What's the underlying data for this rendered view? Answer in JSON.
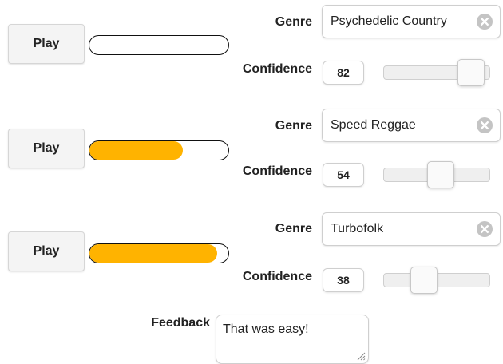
{
  "play_label": "Play",
  "genre_label": "Genre",
  "confidence_label": "Confidence",
  "rows": [
    {
      "genre": "Psychedelic Country",
      "confidence": "82",
      "progress": 0.0
    },
    {
      "genre": "Speed Reggae",
      "confidence": "54",
      "progress": 0.67
    },
    {
      "genre": "Turbofolk",
      "confidence": "38",
      "progress": 0.92
    }
  ],
  "feedback": {
    "label": "Feedback",
    "value": "That was easy!"
  },
  "colors": {
    "progress_fill": "#ffb300"
  },
  "icons": {
    "clear": "clear-circle-x-icon",
    "resize": "resize-grip-icon"
  }
}
